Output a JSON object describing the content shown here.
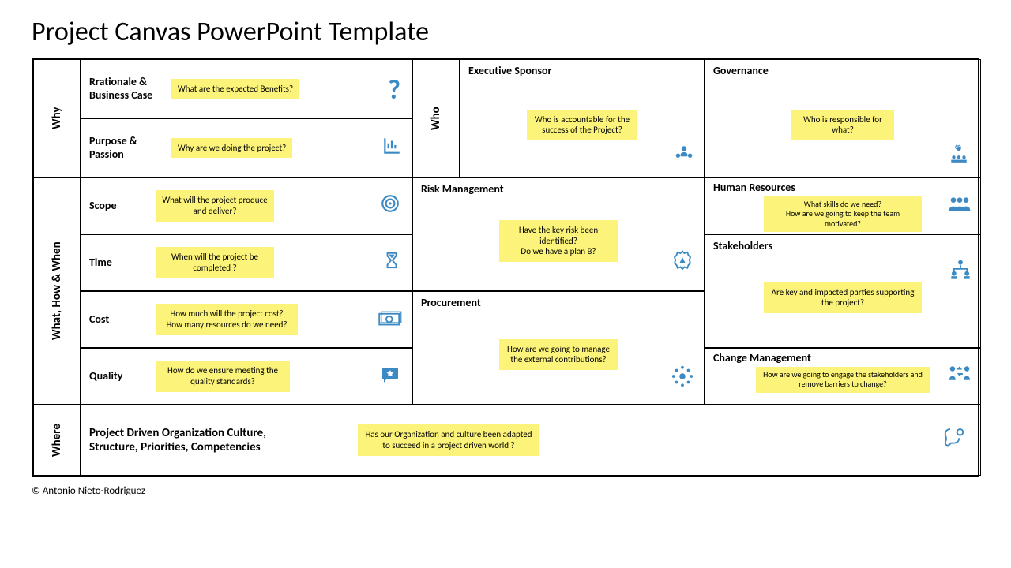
{
  "title": "Project Canvas PowerPoint Template",
  "footer": "© Antonio Nieto-Rodriguez",
  "labels": {
    "why": "Why",
    "who": "Who",
    "what": "What,  How & When",
    "where": "Where"
  },
  "cells": {
    "rationale": {
      "title": "Rrationale & Business Case",
      "note": "What are the expected Benefits?"
    },
    "purpose": {
      "title": "Purpose & Passion",
      "note": "Why are we doing the project?"
    },
    "sponsor": {
      "title": "Executive Sponsor",
      "note": "Who is accountable for the success of the Project?"
    },
    "governance": {
      "title": "Governance",
      "note": "Who is responsible for what?"
    },
    "scope": {
      "title": "Scope",
      "note": "What will the project produce and deliver?"
    },
    "time": {
      "title": "Time",
      "note": "When will the project be completed ?"
    },
    "cost": {
      "title": "Cost",
      "note": "How much will the project cost? How many resources do we need?"
    },
    "quality": {
      "title": "Quality",
      "note": "How do we ensure meeting the quality standards?"
    },
    "risk": {
      "title": "Risk Management",
      "note": "Have the key risk been identified?\nDo we have a plan B?"
    },
    "procurement": {
      "title": "Procurement",
      "note": "How are we going to manage the external contributions?"
    },
    "hr": {
      "title": "Human Resources",
      "note": "What skills do we need?\nHow are we going to keep the team motivated?"
    },
    "stakeholders": {
      "title": "Stakeholders",
      "note": "Are key and impacted parties supporting the project?"
    },
    "change": {
      "title": "Change Management",
      "note": "How are we going to engage the stakeholders and remove barriers to change?"
    },
    "org": {
      "title": "Project Driven Organization Culture, Structure, Priorities, Competencies",
      "note": "Has our Organization and culture been adapted to succeed in a project driven world ?"
    }
  }
}
